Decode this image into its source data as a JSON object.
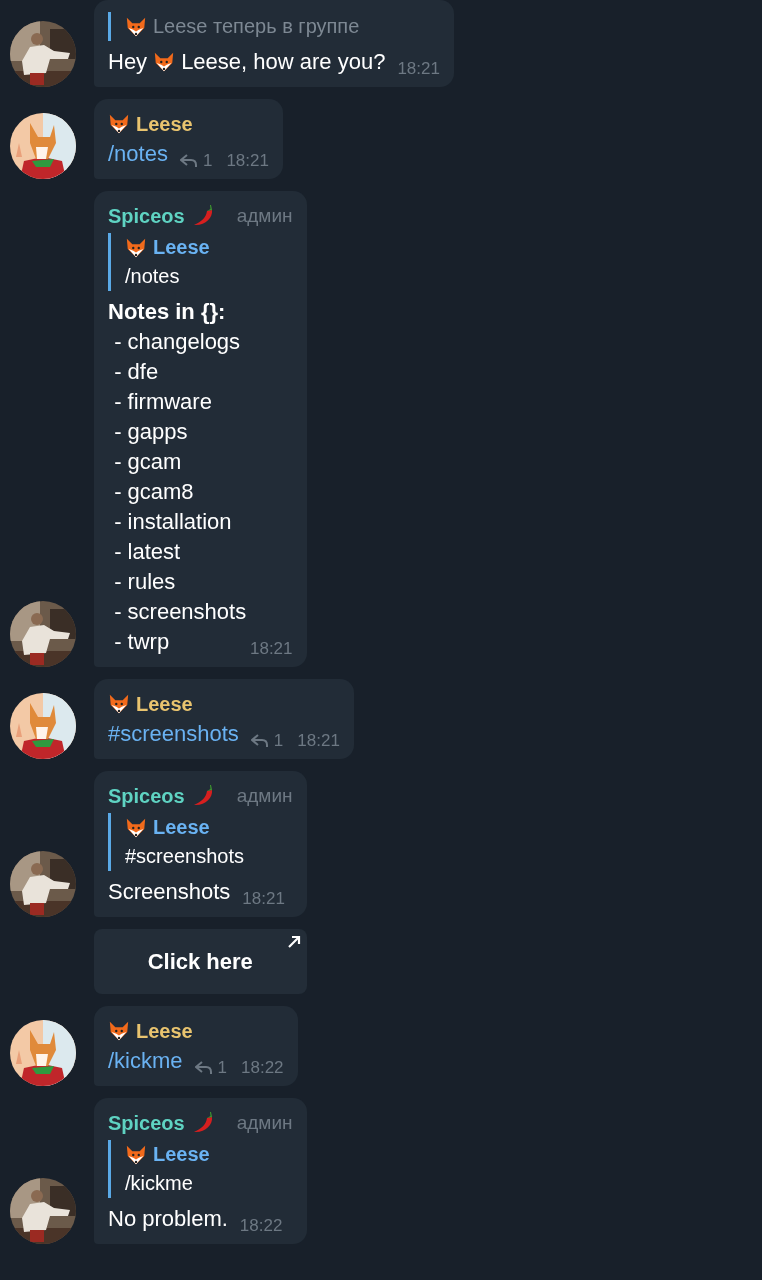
{
  "messages": [
    {
      "kind": "answer",
      "reply_to": {
        "text": "Leese теперь в группе"
      },
      "body": [
        {
          "kind": "text",
          "text": "Hey"
        },
        {
          "kind": "fox"
        },
        {
          "kind": "text",
          "text": "Leese, how are you?"
        }
      ],
      "time": "18:21"
    },
    {
      "kind": "command",
      "sender": {
        "name": "Leese",
        "color": "#e9c46f"
      },
      "body": [
        {
          "kind": "link",
          "text": "/notes"
        }
      ],
      "replies": "1",
      "time": "18:21"
    },
    {
      "kind": "answer",
      "sender": {
        "name": "Spiceos",
        "color": "#5fd3c2",
        "role": "админ"
      },
      "reply_to": {
        "name": "Leese",
        "text": "/notes"
      },
      "body": [
        {
          "kind": "text",
          "text": "**Notes in {}:**\n - changelogs\n - dfe\n - firmware\n - gapps\n - gcam\n - gcam8\n - installation\n - latest\n - rules\n - screenshots\n - twrp"
        }
      ],
      "time": "18:21"
    },
    {
      "kind": "command",
      "sender": {
        "name": "Leese",
        "color": "#e9c46f"
      },
      "body": [
        {
          "kind": "link",
          "text": "#screenshots"
        }
      ],
      "replies": "1",
      "time": "18:21"
    },
    {
      "kind": "answer",
      "sender": {
        "name": "Spiceos",
        "color": "#5fd3c2",
        "role": "админ"
      },
      "reply_to": {
        "name": "Leese",
        "text": "#screenshots"
      },
      "body": [
        {
          "kind": "text",
          "text": "Screenshots"
        }
      ],
      "time": "18:21",
      "buttons": [
        {
          "label": "Click here",
          "kind": "url"
        }
      ]
    },
    {
      "kind": "command",
      "sender": {
        "name": "Leese",
        "color": "#e9c46f"
      },
      "body": [
        {
          "kind": "link",
          "text": "/kickme"
        }
      ],
      "replies": "1",
      "time": "18:22"
    },
    {
      "kind": "answer",
      "sender": {
        "name": "Spiceos",
        "color": "#5fd3c2",
        "role": "админ"
      },
      "reply_to": {
        "name": "Leese",
        "text": "/kickme"
      },
      "body": [
        {
          "kind": "text",
          "text": "No problem."
        }
      ],
      "time": "18:22"
    }
  ]
}
